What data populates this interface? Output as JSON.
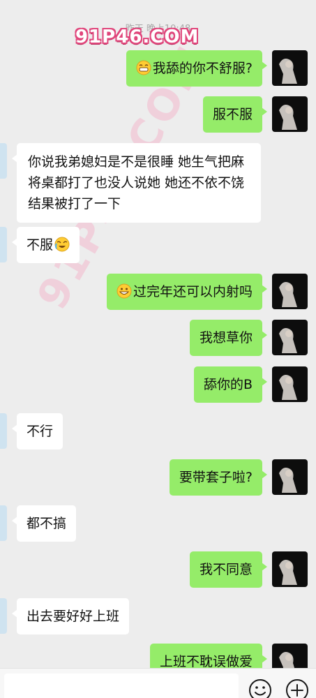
{
  "header": {
    "timestamp": "昨天 晚上10:48",
    "watermark": "91P46.COM",
    "diagonal_watermark": "91P46.COM"
  },
  "messages": [
    {
      "sender": "me",
      "emoji": "grin-sweat-face",
      "text": "我舔的你不舒服?"
    },
    {
      "sender": "me",
      "text": "服不服"
    },
    {
      "sender": "them",
      "text": "你说我弟媳妇是不是很睡  她生气把麻将桌都打了也没人说她  她还不依不饶结果被打了一下"
    },
    {
      "sender": "them",
      "text": "不服",
      "emoji_end": "crying-laugh-face"
    },
    {
      "sender": "me",
      "emoji": "grin-face",
      "text": "过完年还可以内射吗"
    },
    {
      "sender": "me",
      "text": "我想草你"
    },
    {
      "sender": "me",
      "text": "舔你的B"
    },
    {
      "sender": "them",
      "text": "不行"
    },
    {
      "sender": "me",
      "text": "要带套子啦?"
    },
    {
      "sender": "them",
      "text": "都不搞"
    },
    {
      "sender": "me",
      "text": "我不同意"
    },
    {
      "sender": "them",
      "text": "出去要好好上班"
    },
    {
      "sender": "me",
      "text": "上班不耽误做爱"
    }
  ],
  "input_bar": {
    "input_value": "",
    "emoji_icon": "smile-icon",
    "plus_icon": "plus-circle-icon"
  },
  "colors": {
    "background": "#ededed",
    "my_bubble": "#95ec69",
    "their_bubble": "#ffffff",
    "watermark_pink": "#e0457b"
  }
}
